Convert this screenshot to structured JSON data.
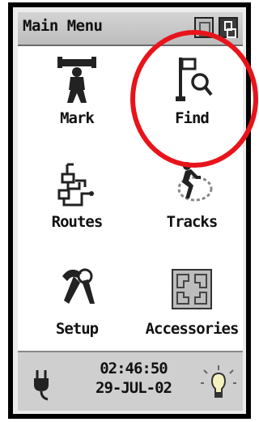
{
  "titlebar": {
    "title": "Main Menu",
    "buttons": [
      "page-icon",
      "window-icon"
    ]
  },
  "menu": {
    "items": [
      {
        "label": "Mark",
        "icon": "mark-icon"
      },
      {
        "label": "Find",
        "icon": "find-icon"
      },
      {
        "label": "Routes",
        "icon": "routes-icon"
      },
      {
        "label": "Tracks",
        "icon": "tracks-icon"
      },
      {
        "label": "Setup",
        "icon": "setup-icon"
      },
      {
        "label": "Accessories",
        "icon": "accessories-icon"
      }
    ]
  },
  "status": {
    "time": "02:46:50",
    "date": "29-JUL-02",
    "left_icon": "power-plug-icon",
    "right_icon": "backlight-icon"
  },
  "colors": {
    "highlight_circle": "#e8141b",
    "titlebar": "#c8c8c8",
    "statusbar": "#cfcfcf"
  }
}
